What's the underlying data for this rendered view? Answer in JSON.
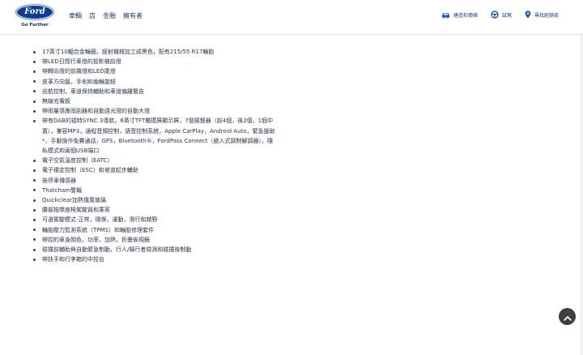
{
  "header": {
    "logo_word": "Ford",
    "logo_tagline": "Go Further",
    "nav": [
      "車輛",
      "店",
      "金融",
      "擁有者"
    ],
    "utilities": [
      {
        "icon": "car-price-icon",
        "label": "建造和價格"
      },
      {
        "icon": "steering-wheel-icon",
        "label": "試駕"
      },
      {
        "icon": "location-pin-icon",
        "label": "尋找經銷商"
      }
    ]
  },
  "features": [
    "17英寸10輻合金輪圈，經射機械加工成黑色，配有215/55 R17輪胎",
    "帶LED日間行車燈的投影機前燈",
    "帶轉向燈的前霧燈和LED尾燈",
    "皮革方向盤，手剎和齒輪旋鈕",
    "巡航控制，車道保持輔助和車道偏離警告",
    "無線充電板",
    "帶雨量感應雨刮器和自動遠光燈的自動大燈",
    "帶有DAB的福特SYNC 3導航，8英寸TFT觸摸屏顯示屏，7個揚聲器（前4個，後2個，1個中置），兼容MP3，通程音頻控制，語音控制系統，Apple CarPlay，Android Auto，緊急援助*，手動操作免費通話，GPS，Bluetooth®，FordPass Connect（嵌入式調制解調器），隨私模式和兩個USB端口",
    "電子空氣溫度控制（EATC）",
    "電子穩定控制（ESC）和坡道起步輔助",
    "後停車傳感器",
    "Thatcham警報",
    "Quickclear加熱擋風玻璃",
    "腰部按摩座椅駕駛員和乘客",
    "可選駕駛模式-正常，環保，運動，滑行和越野",
    "輪胎壓力監測系統（TPMS）和輪胎修理套件",
    "帶控的車身顏色，功率，加熱，折疊後視鏡",
    "碰撞前輔助與自動緊急制動，行人/騎行者檢測和碰撞後制動",
    "帶扶手和行李箱的中控台"
  ],
  "colors": {
    "brand_blue": "#0b3d91",
    "nav_text": "#1a3e7a",
    "body_text": "#2b3548"
  }
}
